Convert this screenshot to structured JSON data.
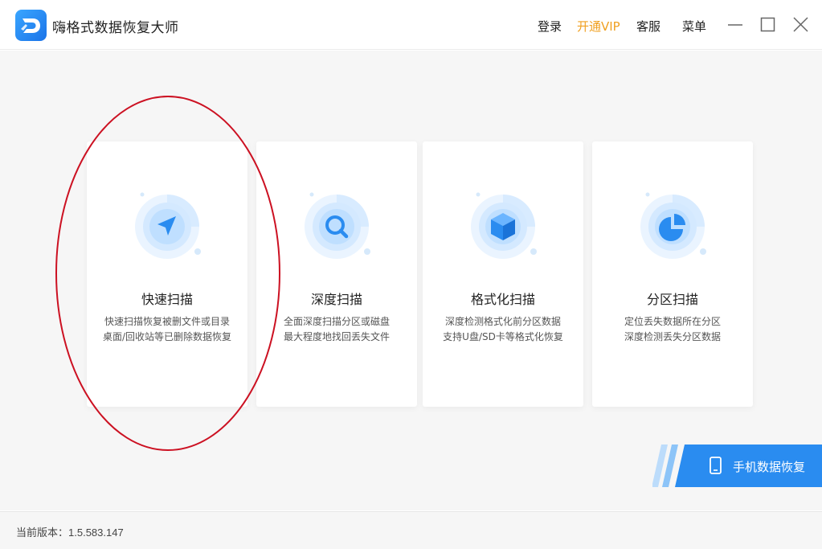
{
  "app": {
    "title": "嗨格式数据恢复大师"
  },
  "header": {
    "login": "登录",
    "vip": "开通VIP",
    "service": "客服",
    "menu": "菜单"
  },
  "cards": [
    {
      "title": "快速扫描",
      "desc1": "快速扫描恢复被删文件或目录",
      "desc2": "桌面/回收站等已删除数据恢复",
      "icon": "navigation-arrow-icon"
    },
    {
      "title": "深度扫描",
      "desc1": "全面深度扫描分区或磁盘",
      "desc2": "最大程度地找回丢失文件",
      "icon": "magnifier-icon"
    },
    {
      "title": "格式化扫描",
      "desc1": "深度检测格式化前分区数据",
      "desc2": "支持U盘/SD卡等格式化恢复",
      "icon": "cube-icon"
    },
    {
      "title": "分区扫描",
      "desc1": "定位丢失数据所在分区",
      "desc2": "深度检测丢失分区数据",
      "icon": "pie-chart-icon"
    }
  ],
  "mobile": {
    "label": "手机数据恢复"
  },
  "footer": {
    "version_label": "当前版本：",
    "version": "1.5.583.147"
  },
  "colors": {
    "accent": "#2a8cf0",
    "vip": "#f0a020",
    "annotation": "#cc1122"
  }
}
